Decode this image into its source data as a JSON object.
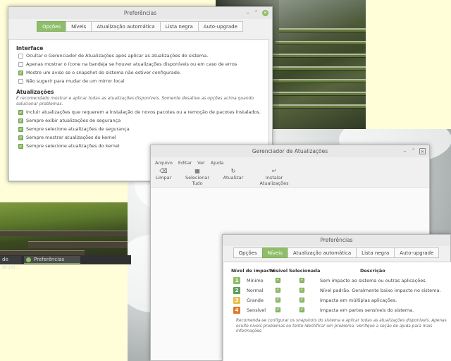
{
  "prefs1": {
    "title": "Preferências",
    "tabs": [
      "Opções",
      "Níveis",
      "Atualização automática",
      "Lista negra",
      "Auto-upgrade"
    ],
    "interface_title": "Interface",
    "interface_options": [
      {
        "label": "Ocultar o Gerenciador de Atualizações após aplicar as atualizações do sistema.",
        "checked": false
      },
      {
        "label": "Apenas mostrar o ícone na bandeja se houver atualizações disponíveis ou em caso de erros",
        "checked": false
      },
      {
        "label": "Mostre um aviso se o snapshot do sistema não estiver configurado.",
        "checked": true
      },
      {
        "label": "Não sugerir para mudar de um mirror local",
        "checked": false
      }
    ],
    "updates_title": "Atualizações",
    "updates_note": "É recomendado mostrar e aplicar todas as atualizações disponíveis. Somente desative as opções acima quando solucionar problemas.",
    "updates_options": [
      {
        "label": "Incluir atualizações que requerem a instalação de novos pacotes ou a remoção de pacotes instalados.",
        "checked": true
      },
      {
        "label": "Sempre exibir atualizações de segurança",
        "checked": true
      },
      {
        "label": "Sempre selecione atualizações de segurança",
        "checked": true
      },
      {
        "label": "Sempre mostrar atualizações do kernel",
        "checked": true
      },
      {
        "label": "Sempre selecione atualizações do kernel",
        "checked": true
      }
    ]
  },
  "taskbar": {
    "item1": "de Atual...",
    "item2": "Preferências"
  },
  "updater": {
    "title": "Gerenciador de Atualizações",
    "menu": [
      "Arquivo",
      "Editar",
      "Ver",
      "Ajuda"
    ],
    "toolbar": [
      {
        "label": "Limpar",
        "icon": "clear-icon"
      },
      {
        "label": "Selecionar Tudo",
        "icon": "select-all-icon"
      },
      {
        "label": "Atualizar",
        "icon": "refresh-icon"
      },
      {
        "label": "Instalar Atualizações",
        "icon": "install-icon"
      }
    ]
  },
  "prefs2": {
    "title": "Preferências",
    "tabs": [
      "Opções",
      "Níveis",
      "Atualização automática",
      "Lista negra",
      "Auto-upgrade"
    ],
    "headers": {
      "level": "Nível de impacto",
      "visible": "Visível",
      "selected": "Selecionada",
      "description": "Descrição"
    },
    "levels": [
      {
        "num": "1",
        "name": "Mínimo",
        "color": "#8fbe6a",
        "desc": "Sem impacto ao sistema ou outras aplicações."
      },
      {
        "num": "2",
        "name": "Normal",
        "color": "#5aa05a",
        "desc": "Nível padrão. Geralmente baixo impacto no sistema."
      },
      {
        "num": "3",
        "name": "Grande",
        "color": "#e8c04a",
        "desc": "Impacta em múltiplas aplicações."
      },
      {
        "num": "4",
        "name": "Sensível",
        "color": "#e07a2a",
        "desc": "Impacta em partes sensíveis do sistema."
      }
    ],
    "note": "Recomenda-se configurar os snapshots do sistema e aplicar todas as atualizações disponíveis. Apenas oculte níveis problemas ou tente identificar um problema. Verifique a seção de ajuda para mais informações."
  }
}
